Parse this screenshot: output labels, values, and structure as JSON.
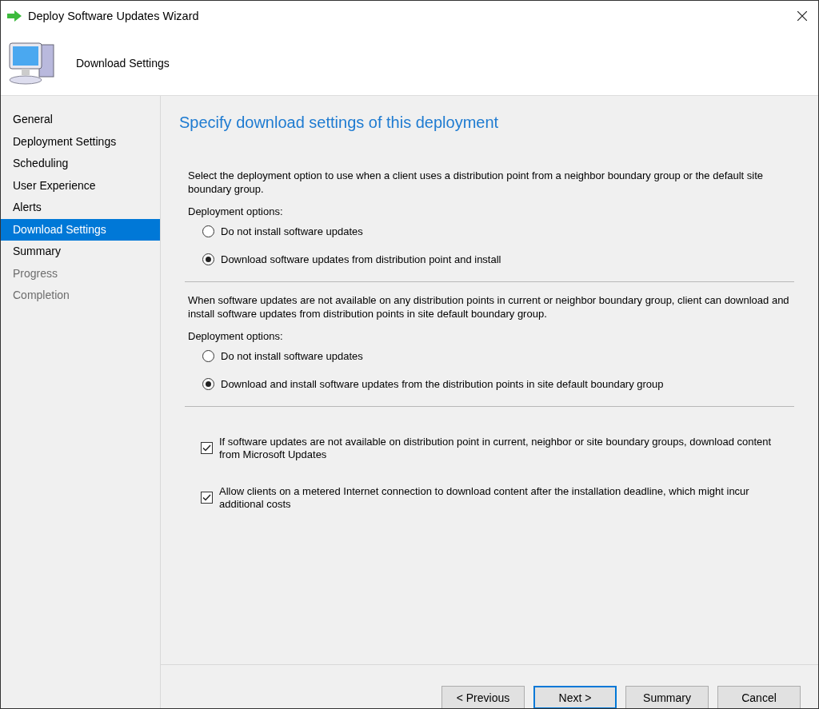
{
  "window": {
    "title": "Deploy Software Updates Wizard"
  },
  "header": {
    "title": "Download Settings"
  },
  "sidebar": {
    "items": [
      {
        "label": "General",
        "selected": false,
        "disabled": false
      },
      {
        "label": "Deployment Settings",
        "selected": false,
        "disabled": false
      },
      {
        "label": "Scheduling",
        "selected": false,
        "disabled": false
      },
      {
        "label": "User Experience",
        "selected": false,
        "disabled": false
      },
      {
        "label": "Alerts",
        "selected": false,
        "disabled": false
      },
      {
        "label": "Download Settings",
        "selected": true,
        "disabled": false
      },
      {
        "label": "Summary",
        "selected": false,
        "disabled": false
      },
      {
        "label": "Progress",
        "selected": false,
        "disabled": true
      },
      {
        "label": "Completion",
        "selected": false,
        "disabled": true
      }
    ]
  },
  "content": {
    "heading": "Specify download settings of this deployment",
    "sections": [
      {
        "description": "Select the deployment option to use when a client uses a distribution point from a neighbor boundary group or the default site boundary group.",
        "group_label": "Deployment options:",
        "options": [
          {
            "label": "Do not install software updates",
            "selected": false
          },
          {
            "label": "Download software updates from distribution point and install",
            "selected": true
          }
        ]
      },
      {
        "description": "When software updates are not available on any distribution points in current or neighbor boundary group, client can download and install software updates from distribution points in site default boundary group.",
        "group_label": "Deployment options:",
        "options": [
          {
            "label": "Do not install software updates",
            "selected": false
          },
          {
            "label": "Download and install software updates from the distribution points in site default boundary group",
            "selected": true
          }
        ]
      }
    ],
    "checkboxes": [
      {
        "label": "If software updates are not available on distribution point in current, neighbor or site boundary groups, download content from Microsoft Updates",
        "checked": true
      },
      {
        "label": "Allow clients on a metered Internet connection to download content after the installation deadline, which might incur additional costs",
        "checked": true
      }
    ]
  },
  "buttons": [
    {
      "label": "< Previous",
      "default": false
    },
    {
      "label": "Next >",
      "default": true
    },
    {
      "label": "Summary",
      "default": false
    },
    {
      "label": "Cancel",
      "default": false
    }
  ]
}
